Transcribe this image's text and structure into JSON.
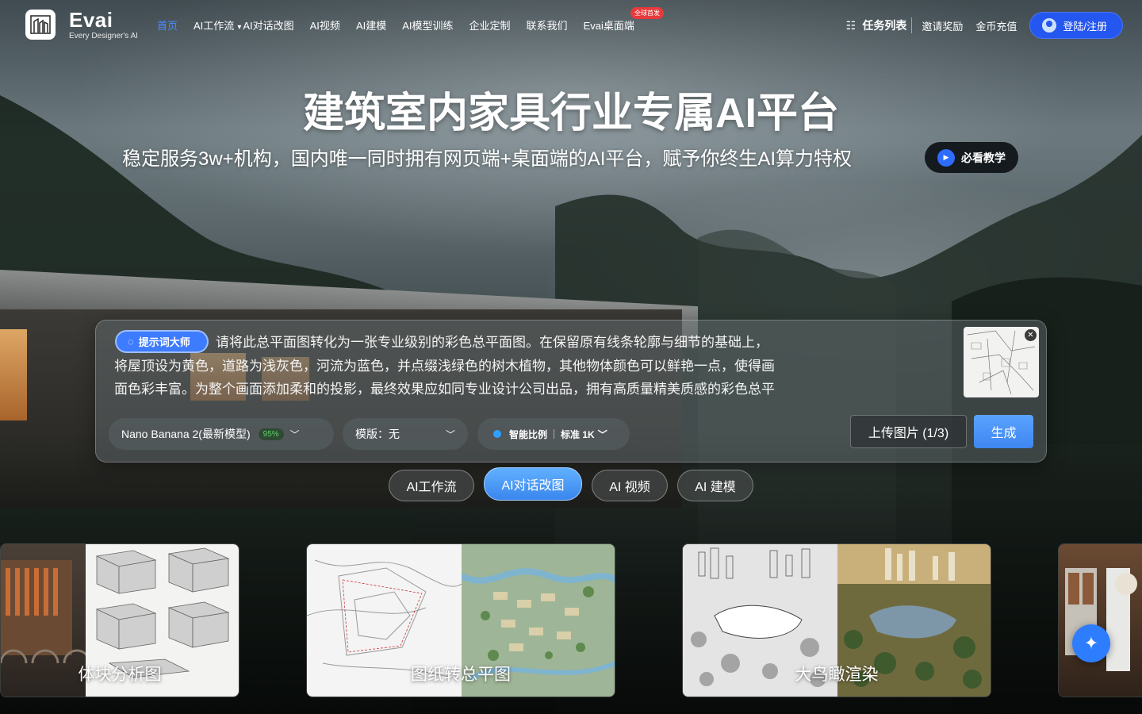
{
  "brand": {
    "name": "Evai",
    "tagline": "Every Designer's AI"
  },
  "nav": {
    "items": [
      {
        "label": "首页",
        "active": true
      },
      {
        "label": "AI工作流",
        "active": false
      },
      {
        "label": "AI对话改图",
        "active": false,
        "caret": "▾"
      },
      {
        "label": "AI视频",
        "active": false
      },
      {
        "label": "AI建模",
        "active": false
      },
      {
        "label": "AI模型训练",
        "active": false
      },
      {
        "label": "企业定制",
        "active": false
      },
      {
        "label": "联系我们",
        "active": false
      },
      {
        "label": "Evai桌面端",
        "active": false
      }
    ],
    "new_badge": "全球首发"
  },
  "header_right": {
    "tasks_label": "任务列表",
    "invite_label": "邀请奖励",
    "recharge_label": "金币充值",
    "login_label": "登陆/注册"
  },
  "hero": {
    "title": "建筑室内家具行业专属AI平台",
    "subtitle": "稳定服务3w+机构，国内唯一同时拥有网页端+桌面端的AI平台，赋予你终生AI算力特权",
    "tutorial_label": "必看教学"
  },
  "prompt": {
    "master_label": "提示词大师",
    "text": "请将此总平面图转化为一张专业级别的彩色总平面图。在保留原有线条轮廓与细节的基础上，将屋顶设为黄色，道路为浅灰色，河流为蓝色，并点缀浅绿色的树木植物，其他物体颜色可以鲜艳一点，使得画面色彩丰富。为整个画面添加柔和的投影，最终效果应如同专业设计公司出品，拥有高质量精美质感的彩色总平面图。",
    "model_label": " Nano Banana 2(最新模型)",
    "model_percent": "95%",
    "template_label": "模版：无",
    "ratio_label": "智能比例",
    "quality_label": "标准 1K",
    "upload_label": "上传图片 (1/3)",
    "generate_label": "生成"
  },
  "tabs": [
    {
      "label": "AI工作流",
      "active": false
    },
    {
      "label": "AI对话改图",
      "active": true
    },
    {
      "label": "AI 视频",
      "active": false
    },
    {
      "label": "AI 建模",
      "active": false
    }
  ],
  "cards": [
    {
      "label": "体块分析图"
    },
    {
      "label": "图纸转总平图"
    },
    {
      "label": "大鸟瞰渲染"
    }
  ],
  "icons": {
    "tasks": "list-check-icon",
    "bulb": "lightbulb-icon",
    "play": "play-icon",
    "close": "close-icon",
    "chevron": "chevron-down-icon",
    "fab": "sparkle-icon"
  },
  "colors": {
    "accent": "#2456f0",
    "active_nav": "#4d8cff",
    "generate": "#3f86f0"
  }
}
